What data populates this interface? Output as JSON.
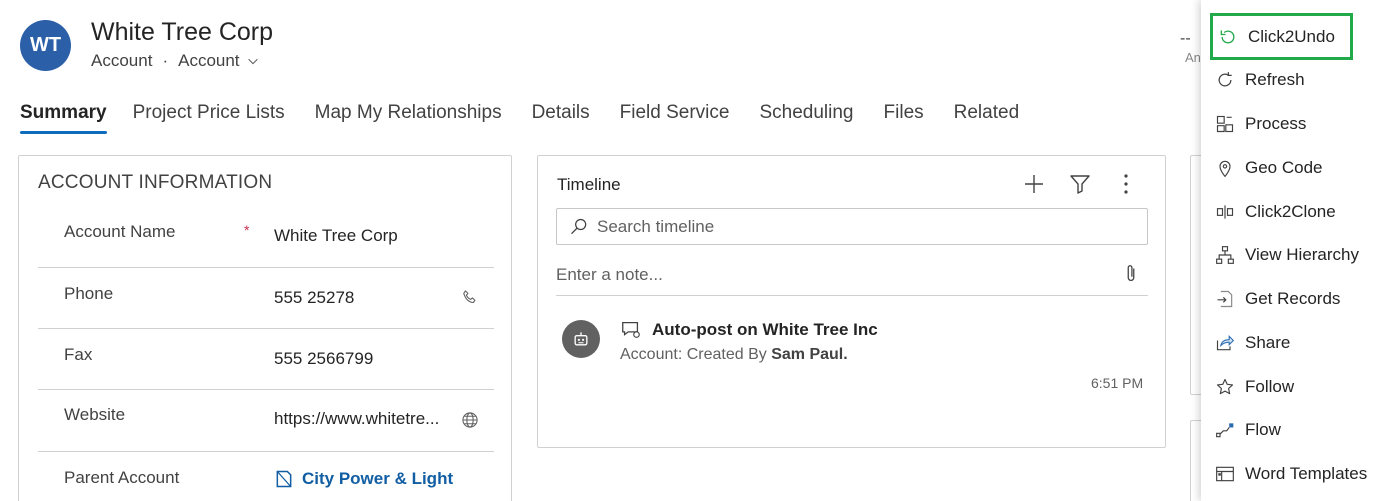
{
  "record": {
    "initials": "WT",
    "title": "White Tree Corp",
    "entity": "Account",
    "separator": "·",
    "form": "Account"
  },
  "header_right": {
    "value": "--",
    "label": "An"
  },
  "tabs": [
    {
      "label": "Summary"
    },
    {
      "label": "Project Price Lists"
    },
    {
      "label": "Map My Relationships"
    },
    {
      "label": "Details"
    },
    {
      "label": "Field Service"
    },
    {
      "label": "Scheduling"
    },
    {
      "label": "Files"
    },
    {
      "label": "Related"
    }
  ],
  "account_info": {
    "title": "ACCOUNT INFORMATION",
    "required_mark": "*",
    "fields": [
      {
        "label": "Account Name",
        "value": "White Tree Corp"
      },
      {
        "label": "Phone",
        "value": "555 25278"
      },
      {
        "label": "Fax",
        "value": "555 2566799"
      },
      {
        "label": "Website",
        "value": "https://www.whitetre..."
      },
      {
        "label": "Parent Account",
        "value": "City Power & Light"
      }
    ]
  },
  "timeline": {
    "title": "Timeline",
    "search_placeholder": "Search timeline",
    "note_placeholder": "Enter a note...",
    "item": {
      "title": "Auto-post on White Tree Inc",
      "sub_prefix": "Account: Created By",
      "sub_user": "Sam Paul.",
      "time": "6:51 PM"
    }
  },
  "menu": {
    "items": [
      {
        "label": "Click2Undo",
        "icon": "undo-icon"
      },
      {
        "label": "Refresh",
        "icon": "refresh-icon"
      },
      {
        "label": "Process",
        "icon": "process-icon"
      },
      {
        "label": "Geo Code",
        "icon": "location-pin-icon"
      },
      {
        "label": "Click2Clone",
        "icon": "clone-icon"
      },
      {
        "label": "View Hierarchy",
        "icon": "hierarchy-icon"
      },
      {
        "label": "Get Records",
        "icon": "get-records-icon"
      },
      {
        "label": "Share",
        "icon": "share-icon"
      },
      {
        "label": "Follow",
        "icon": "star-icon"
      },
      {
        "label": "Flow",
        "icon": "flow-icon"
      },
      {
        "label": "Word Templates",
        "icon": "word-templates-icon"
      }
    ]
  },
  "colors": {
    "accent": "#0f6cbd",
    "avatar": "#2b5fa8",
    "highlight_border": "#22a94a",
    "link": "#115ea3",
    "required": "#c4314b"
  }
}
